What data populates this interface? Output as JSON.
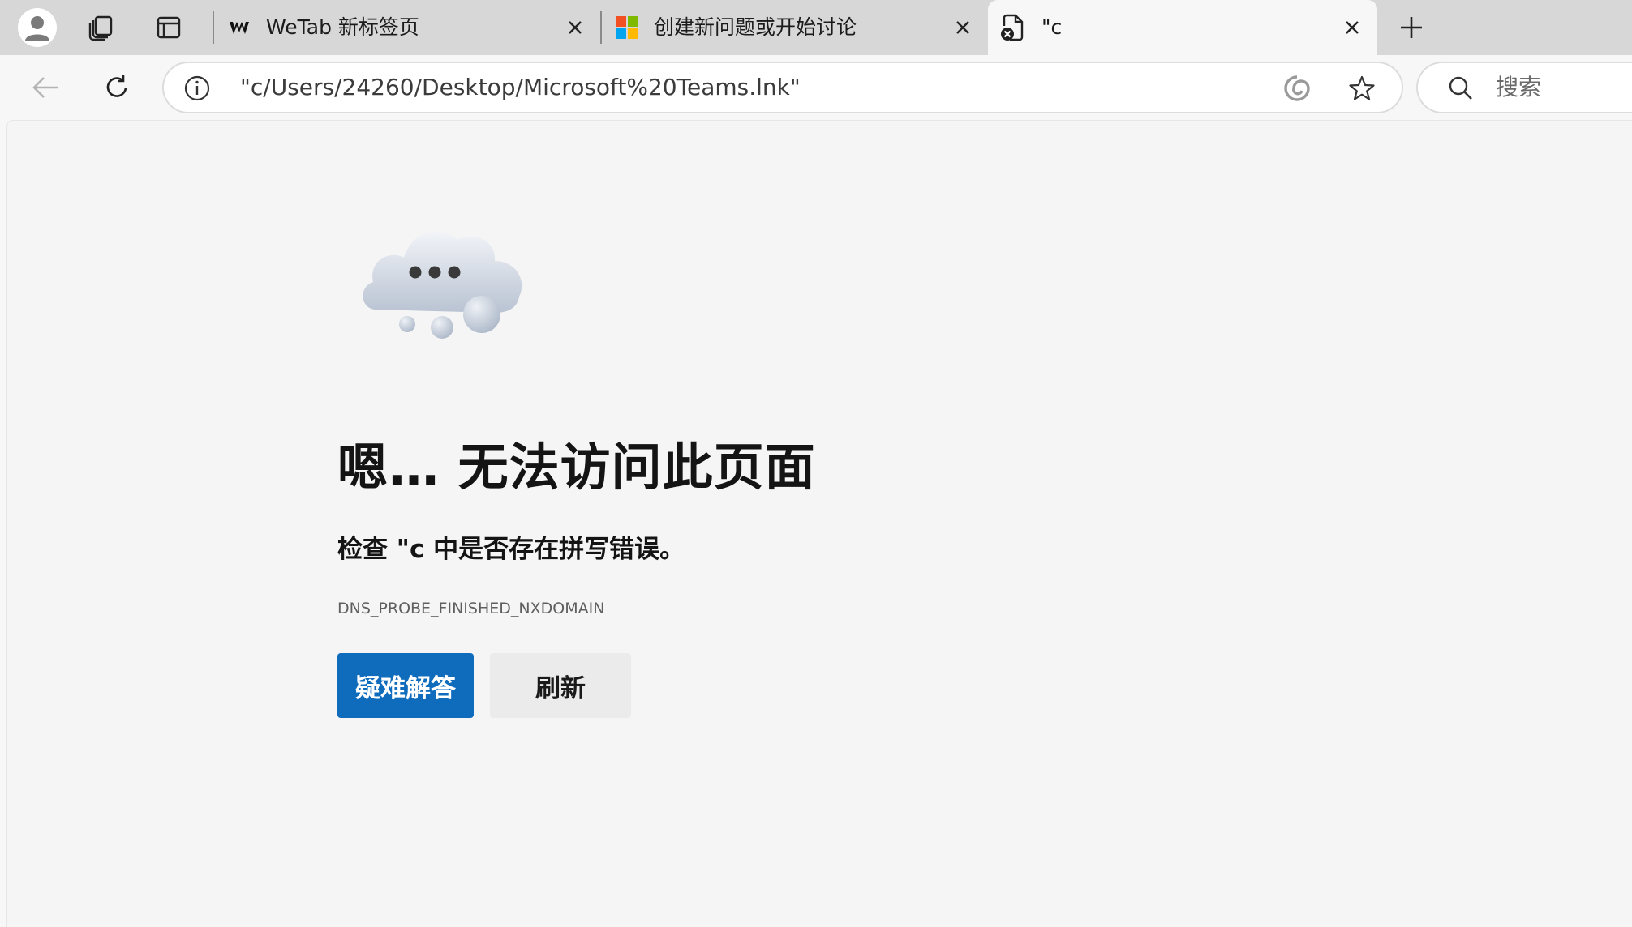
{
  "tabs": [
    {
      "title": "WeTab 新标签页",
      "icon": "wetab-logo-icon"
    },
    {
      "title": "创建新问题或开始讨论",
      "icon": "microsoft-logo-icon"
    },
    {
      "title": "\"c",
      "icon": "broken-page-icon",
      "active": true
    }
  ],
  "toolbar": {
    "url": "\"c/Users/24260/Desktop/Microsoft%20Teams.lnk\"",
    "search_placeholder": "搜索"
  },
  "error_page": {
    "headline": "嗯… 无法访问此页面",
    "suggestion": "检查 \"c 中是否存在拼写错误。",
    "error_code": "DNS_PROBE_FINISHED_NXDOMAIN",
    "troubleshoot_label": "疑难解答",
    "refresh_label": "刷新"
  },
  "colors": {
    "primary_button": "#0f6cbd",
    "tab_strip": "#d7d7d7",
    "page_background": "#f5f5f5"
  }
}
